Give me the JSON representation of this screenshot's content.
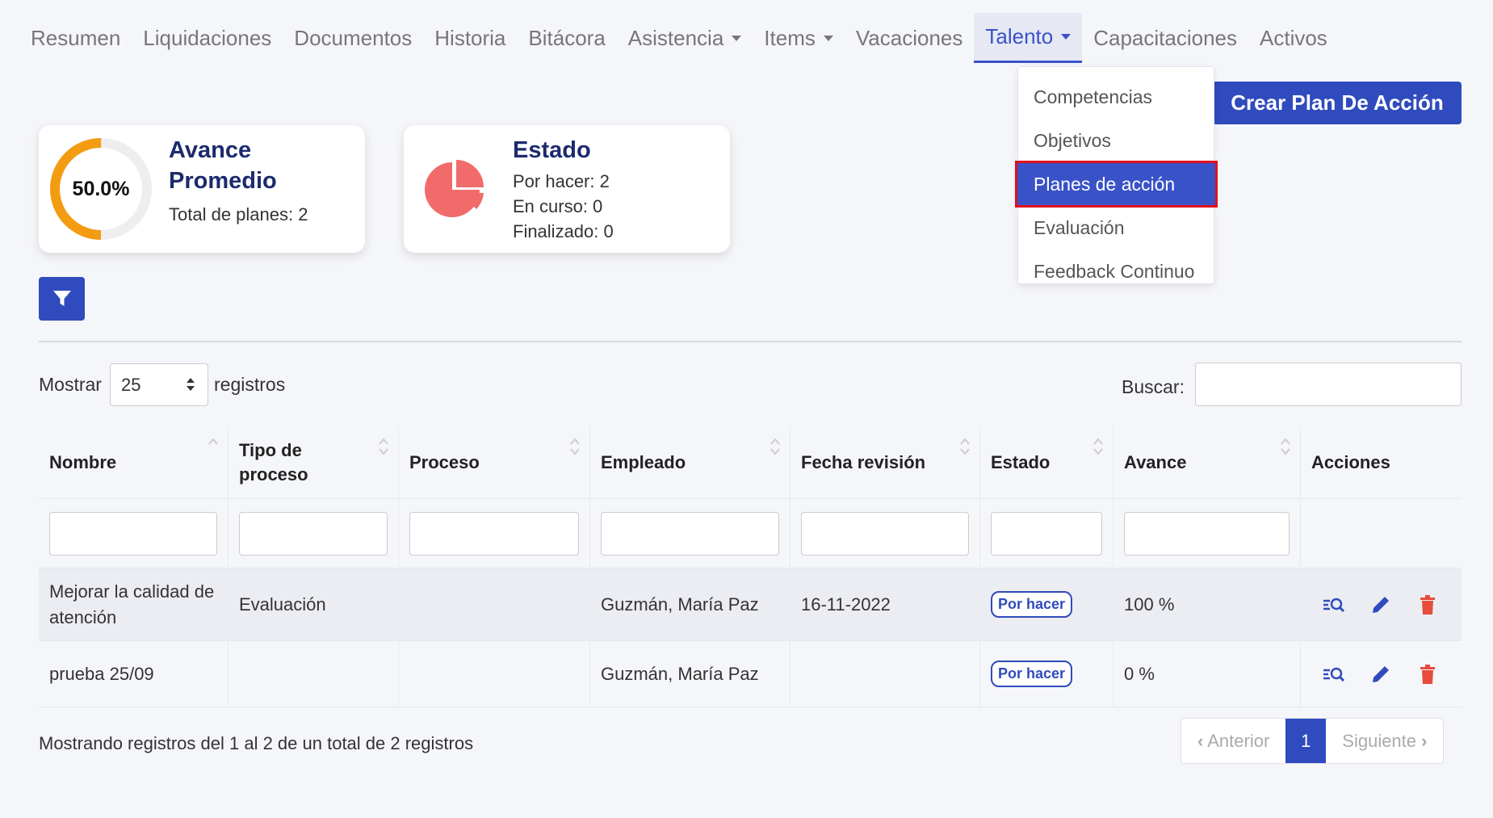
{
  "nav": {
    "items": [
      {
        "label": "Resumen",
        "dropdown": false
      },
      {
        "label": "Liquidaciones",
        "dropdown": false
      },
      {
        "label": "Documentos",
        "dropdown": false
      },
      {
        "label": "Historia",
        "dropdown": false
      },
      {
        "label": "Bitácora",
        "dropdown": false
      },
      {
        "label": "Asistencia",
        "dropdown": true
      },
      {
        "label": "Items",
        "dropdown": true
      },
      {
        "label": "Vacaciones",
        "dropdown": false
      },
      {
        "label": "Talento",
        "dropdown": true,
        "active": true
      },
      {
        "label": "Capacitaciones",
        "dropdown": false
      },
      {
        "label": "Activos",
        "dropdown": false
      }
    ]
  },
  "dropdown": {
    "items": [
      "Competencias",
      "Objetivos",
      "Planes de acción",
      "Evaluación",
      "Feedback Continuo"
    ],
    "selected": "Planes de acción"
  },
  "create_button": "Crear Plan De Acción",
  "cards": {
    "avance": {
      "title": "Avance Promedio",
      "percent_label": "50.0%",
      "percent_value": 0.5,
      "total": "Total de planes: 2"
    },
    "estado": {
      "title": "Estado",
      "lines": [
        "Por hacer: 2",
        "En curso: 0",
        "Finalizado: 0"
      ]
    }
  },
  "table_controls": {
    "show_label": "Mostrar",
    "page_size": "25",
    "records_label": "registros",
    "search_label": "Buscar:"
  },
  "table": {
    "columns": [
      "Nombre",
      "Tipo de proceso",
      "Proceso",
      "Empleado",
      "Fecha revisión",
      "Estado",
      "Avance",
      "Acciones"
    ],
    "rows": [
      {
        "nombre": "Mejorar la calidad de atención",
        "tipo": "Evaluación",
        "proceso": "",
        "empleado": "Guzmán, María Paz",
        "fecha": "16-11-2022",
        "estado": "Por hacer",
        "avance": "100 %"
      },
      {
        "nombre": "prueba 25/09",
        "tipo": "",
        "proceso": "",
        "empleado": "Guzmán, María Paz",
        "fecha": "",
        "estado": "Por hacer",
        "avance": "0 %"
      }
    ]
  },
  "footer": {
    "info": "Mostrando registros del 1 al 2 de un total de 2 registros",
    "prev": "Anterior",
    "page": "1",
    "next": "Siguiente"
  },
  "colors": {
    "primary": "#2f4bbd",
    "donut": "#f39c12",
    "pie": "#f26b6b",
    "delete": "#e74c3c",
    "highlight": "#e0101e"
  },
  "icons": [
    "filter-icon",
    "view-icon",
    "edit-icon",
    "delete-icon",
    "pie-chart-icon"
  ]
}
